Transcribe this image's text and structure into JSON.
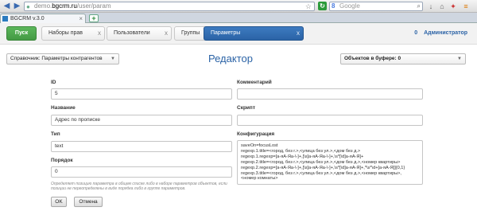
{
  "browser": {
    "url_prefix": "demo.",
    "url_host": "bgcrm.ru",
    "url_path": "/user/param",
    "search_placeholder": "Google",
    "search_engine_icon": "8",
    "tab_title": "BGCRM v.3.0",
    "new_tab": "+"
  },
  "nav": {
    "start": "Пуск",
    "tabs": [
      {
        "label": "Наборы прав",
        "close": "x"
      },
      {
        "label": "Пользователи",
        "close": "x"
      },
      {
        "label": "Группы",
        "close": "x"
      },
      {
        "label": "Параметры",
        "close": "x"
      }
    ],
    "user_count": "0",
    "user_name": "Администратор"
  },
  "toolbar": {
    "directory_label": "Справочник:",
    "directory_value": "Параметры контрагентов",
    "title": "Редактор",
    "buffer": "Объектов в буфере: 0"
  },
  "form": {
    "id_label": "ID",
    "id_value": "5",
    "name_label": "Название",
    "name_value": "Адрес по прописке",
    "type_label": "Тип",
    "type_value": "text",
    "order_label": "Порядок",
    "order_value": "0",
    "hint": "Определяет позицию параметра в общем списке либо в наборе параметров объектов, если позиции не переопределены в виде порядка либо в группе параметров.",
    "comment_label": "Комментарий",
    "comment_value": "",
    "script_label": "Скрипт",
    "script_value": "",
    "config_label": "Конфигурация",
    "config_value": "saveOn=focusLost\nregexp.1.title=<город, без г.>,<улица без ул.>,<дом без д.>\nregexp.1.regexp=[а-яА-Яa-\\-]+,[\\s]а-яА-Яa-\\-]+,\\s*[\\d]а-яА-Я]+\nregexp.2.title=<город, без г.>,<улица без ул.>,<дом без д.>,<номер квартиры>\nregexp.2.regexp=[а-яА-Яa-\\-]+,[\\s]а-яА-Яa-\\-]+,\\s*[\\d]а-яА-Я]+,*\\s*\\d+[а-яА-Я]]{0,1}\nregexp.3.title=<город, без г.>,<улица без ул.>,<дом без д.>,<номер квартиры>,\n<номер комнаты>"
  },
  "buttons": {
    "ok": "OK",
    "cancel": "Отмена"
  },
  "colors": {
    "accent": "#2b63a6",
    "start_green": "#449944"
  }
}
